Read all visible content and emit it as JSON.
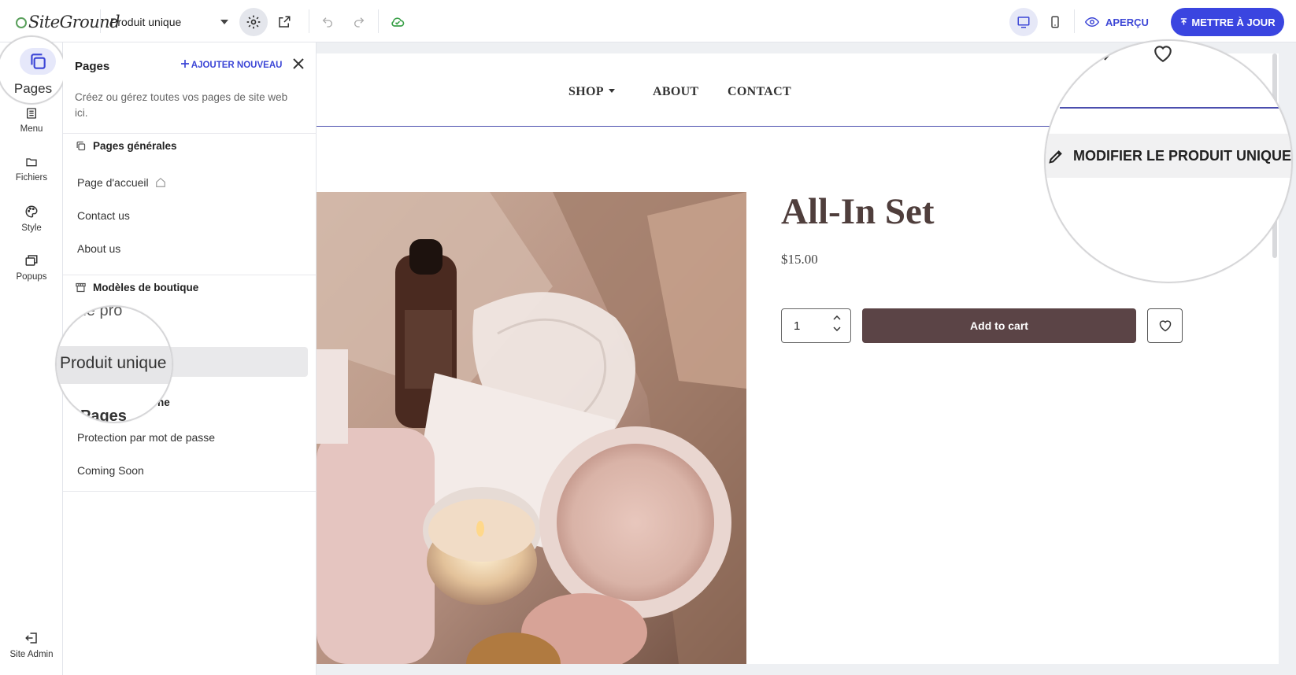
{
  "topbar": {
    "logo": "SiteGround",
    "page_selector": "Produit unique",
    "preview_label": "APERÇU",
    "update_label": "METTRE À JOUR"
  },
  "rail": {
    "pages_label": "Pages",
    "menu_label": "Menu",
    "files_label": "Fichiers",
    "style_label": "Style",
    "popups_label": "Popups",
    "site_admin_label": "Site Admin"
  },
  "panel": {
    "title": "Pages",
    "add_new": "AJOUTER NOUVEAU",
    "description": "Créez ou gérez toutes vos pages de site web ici.",
    "general_heading": "Pages générales",
    "general_pages": [
      "Page d'accueil",
      "Contact us",
      "About us"
    ],
    "shop_heading": "Modèles de boutique",
    "shop_partial": "e de pro",
    "shop_selected": "Produit unique",
    "system_partial": "ne",
    "system_partial_b": "Pages",
    "system_pages": [
      "Protection par mot de passe",
      "Coming Soon"
    ]
  },
  "canvas": {
    "nav": [
      "SHOP",
      "ABOUT",
      "CONTACT"
    ],
    "product_title": "All-In Set",
    "price": "$15.00",
    "qty": "1",
    "add_to_cart": "Add to cart",
    "edit_overlay": "MODIFIER LE PRODUIT UNIQUE"
  },
  "colors": {
    "accent": "#3a45e0",
    "cart_button": "#5b4446",
    "title": "#4f3e3c"
  }
}
